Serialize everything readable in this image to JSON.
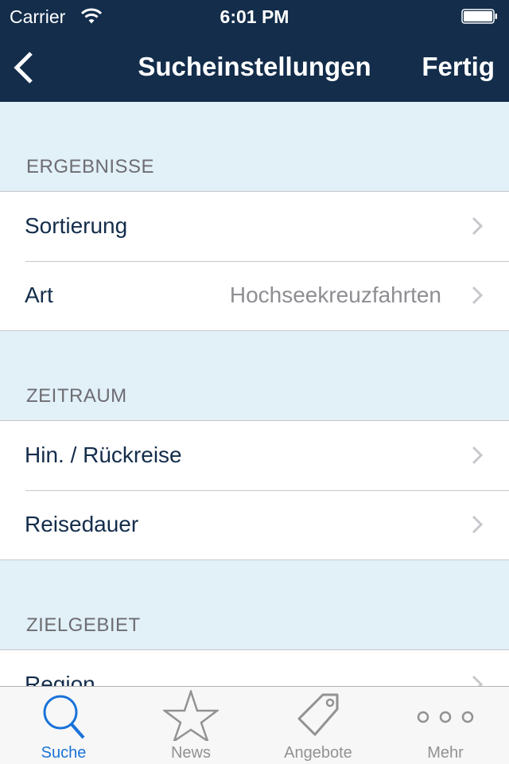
{
  "status_bar": {
    "carrier": "Carrier",
    "time": "6:01 PM"
  },
  "nav": {
    "title": "Sucheinstellungen",
    "done_label": "Fertig"
  },
  "sections": [
    {
      "header": "ERGEBNISSE",
      "rows": [
        {
          "label": "Sortierung",
          "value": ""
        },
        {
          "label": "Art",
          "value": "Hochseekreuzfahrten"
        }
      ]
    },
    {
      "header": "ZEITRAUM",
      "rows": [
        {
          "label": "Hin. / Rückreise",
          "value": ""
        },
        {
          "label": "Reisedauer",
          "value": ""
        }
      ]
    },
    {
      "header": "ZIELGEBIET",
      "rows": [
        {
          "label": "Region",
          "value": ""
        }
      ]
    }
  ],
  "tabs": [
    {
      "label": "Suche",
      "icon": "search-icon",
      "active": true
    },
    {
      "label": "News",
      "icon": "star-icon",
      "active": false
    },
    {
      "label": "Angebote",
      "icon": "tag-icon",
      "active": false
    },
    {
      "label": "Mehr",
      "icon": "more-icon",
      "active": false
    }
  ],
  "colors": {
    "nav_bg": "#132d4b",
    "accent": "#1a73d9",
    "section_bg": "#e2f0f8"
  }
}
